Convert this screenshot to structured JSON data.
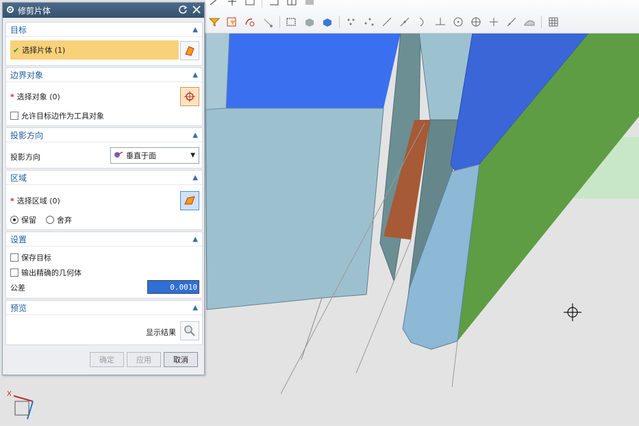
{
  "dialog": {
    "title": "修剪片体",
    "sections": {
      "target": {
        "header": "目标",
        "select_label": "选择片体 (1)"
      },
      "boundary": {
        "header": "边界对象",
        "select_label": "选择对象 (0)",
        "allow_label": "允许目标边作为工具对象"
      },
      "projection": {
        "header": "投影方向",
        "label": "投影方向",
        "dropdown_value": "垂直于面"
      },
      "region": {
        "header": "区域",
        "select_label": "选择区域 (0)",
        "keep_label": "保留",
        "discard_label": "舍弃",
        "selected": "keep"
      },
      "settings": {
        "header": "设置",
        "keep_target_label": "保存目标",
        "output_exact_label": "输出精确的几何体",
        "tolerance_label": "公差",
        "tolerance_value": "0.0010"
      },
      "preview": {
        "header": "预览",
        "show_result_label": "显示结果"
      }
    },
    "buttons": {
      "ok": "确定",
      "apply": "应用",
      "cancel": "取消"
    }
  },
  "axis": {
    "x_label": "X"
  },
  "colors": {
    "title_bg": "#3d5b79",
    "section_header": "#1f5fa6",
    "selected_row": "#f8d17a",
    "required_star": "#d32222",
    "tolerance_bg": "#2f6fd6",
    "model_blue": "#3b6ff0",
    "model_green": "#5d9e46",
    "model_teal": "#98bfd0"
  }
}
